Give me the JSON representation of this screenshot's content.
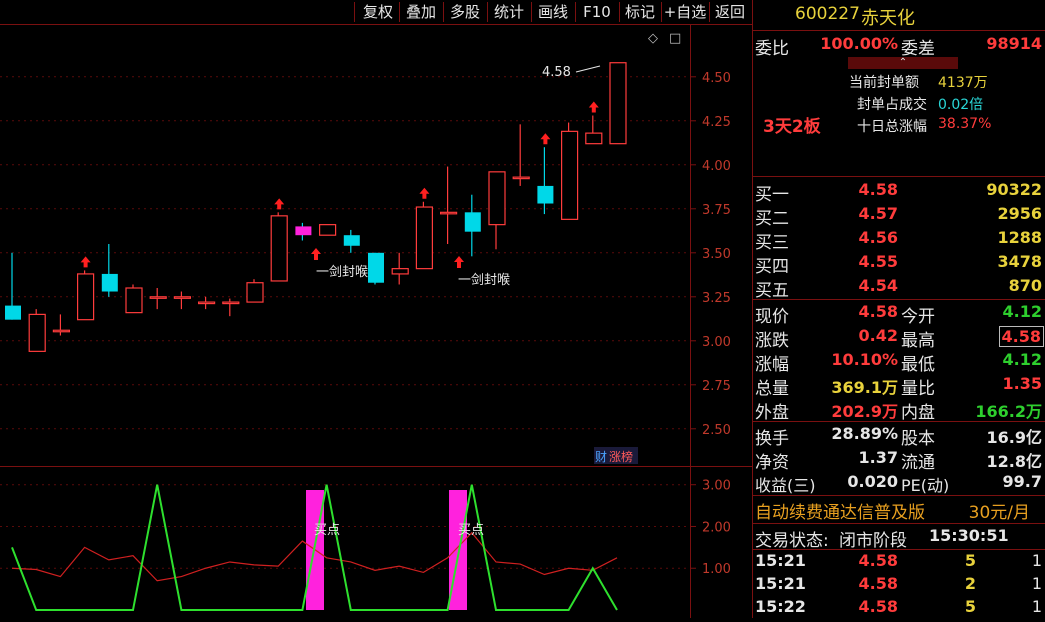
{
  "toolbar": {
    "buttons": [
      "复权",
      "叠加",
      "多股",
      "统计",
      "画线",
      "F10",
      "标记",
      "+自选",
      "返回"
    ]
  },
  "stock": {
    "code": "600227",
    "name": "赤天化"
  },
  "chart_icons": {
    "diamond": "◇",
    "window": "□"
  },
  "price_axis": {
    "labels": [
      "4.50",
      "4.25",
      "4.00",
      "3.75",
      "3.50",
      "3.25",
      "3.00",
      "2.75",
      "2.50"
    ]
  },
  "indicator_axis": {
    "labels": [
      "3.00",
      "2.00",
      "1.00"
    ]
  },
  "annotations": {
    "high_label": "4.58",
    "signal_1": "一剑封喉",
    "signal_2": "一剑封喉",
    "buy_1": "买点",
    "buy_2": "买点",
    "fin_badge_1": "财",
    "fin_badge_2": "涨榜"
  },
  "chart_data": {
    "type": "candlestick",
    "candles": [
      {
        "o": 3.2,
        "h": 3.5,
        "l": 3.12,
        "c": 3.12
      },
      {
        "o": 2.94,
        "h": 3.18,
        "l": 2.94,
        "c": 3.15
      },
      {
        "o": 3.06,
        "h": 3.15,
        "l": 3.03,
        "c": 3.06
      },
      {
        "o": 3.12,
        "h": 3.4,
        "l": 3.12,
        "c": 3.38
      },
      {
        "o": 3.38,
        "h": 3.55,
        "l": 3.25,
        "c": 3.28
      },
      {
        "o": 3.16,
        "h": 3.32,
        "l": 3.16,
        "c": 3.3
      },
      {
        "o": 3.25,
        "h": 3.3,
        "l": 3.18,
        "c": 3.25
      },
      {
        "o": 3.25,
        "h": 3.28,
        "l": 3.18,
        "c": 3.25
      },
      {
        "o": 3.22,
        "h": 3.25,
        "l": 3.18,
        "c": 3.22
      },
      {
        "o": 3.22,
        "h": 3.24,
        "l": 3.14,
        "c": 3.22
      },
      {
        "o": 3.22,
        "h": 3.35,
        "l": 3.22,
        "c": 3.33
      },
      {
        "o": 3.34,
        "h": 3.73,
        "l": 3.34,
        "c": 3.71
      },
      {
        "o": 3.65,
        "h": 3.67,
        "l": 3.57,
        "c": 3.6
      },
      {
        "o": 3.6,
        "h": 3.66,
        "l": 3.6,
        "c": 3.66
      },
      {
        "o": 3.6,
        "h": 3.63,
        "l": 3.5,
        "c": 3.54
      },
      {
        "o": 3.5,
        "h": 3.5,
        "l": 3.32,
        "c": 3.33
      },
      {
        "o": 3.38,
        "h": 3.5,
        "l": 3.32,
        "c": 3.41
      },
      {
        "o": 3.41,
        "h": 3.79,
        "l": 3.41,
        "c": 3.76
      },
      {
        "o": 3.73,
        "h": 3.99,
        "l": 3.55,
        "c": 3.73
      },
      {
        "o": 3.73,
        "h": 3.83,
        "l": 3.48,
        "c": 3.62
      },
      {
        "o": 3.66,
        "h": 3.96,
        "l": 3.52,
        "c": 3.96
      },
      {
        "o": 3.93,
        "h": 4.23,
        "l": 3.88,
        "c": 3.93
      },
      {
        "o": 3.88,
        "h": 4.1,
        "l": 3.72,
        "c": 3.78
      },
      {
        "o": 3.69,
        "h": 4.24,
        "l": 3.69,
        "c": 4.19
      },
      {
        "o": 4.12,
        "h": 4.28,
        "l": 4.12,
        "c": 4.18
      },
      {
        "o": 4.12,
        "h": 4.58,
        "l": 4.12,
        "c": 4.58
      }
    ],
    "ylim": [
      2.3,
      4.8
    ],
    "up_arrows_at": [
      2,
      10,
      16,
      21,
      23,
      24
    ],
    "indicator": {
      "green": [
        1.5,
        0,
        0,
        0,
        0,
        0,
        3,
        0,
        0,
        0,
        0,
        0,
        0,
        3,
        0,
        0,
        0,
        0,
        0,
        3,
        0,
        0,
        0,
        0,
        1,
        0
      ],
      "red": [
        1,
        0.97,
        0.8,
        1.5,
        1.2,
        1.3,
        0.7,
        0.8,
        1.0,
        1.15,
        1.08,
        1.05,
        1.65,
        1.25,
        1.15,
        0.95,
        1.05,
        0.9,
        1.25,
        1.85,
        1.15,
        1.1,
        0.85,
        1.0,
        0.95,
        1.25
      ],
      "buy_bars_at": [
        13,
        19
      ],
      "ylim": [
        0,
        3.4
      ]
    }
  },
  "panel": {
    "weibi_label": "委比",
    "weibi_value": "100.00%",
    "weicha_label": "委差",
    "weicha_value": "98914",
    "seal_amount_label": "当前封单额",
    "seal_amount_value": "4137万",
    "seal_ratio_label": "封单占成交",
    "seal_ratio_value": "0.02倍",
    "ten_day_label": "十日总涨幅",
    "ten_day_value": "38.37%",
    "streak": "3天2板",
    "bids": [
      {
        "label": "买一",
        "price": "4.58",
        "vol": "90322"
      },
      {
        "label": "买二",
        "price": "4.57",
        "vol": "2956"
      },
      {
        "label": "买三",
        "price": "4.56",
        "vol": "1288"
      },
      {
        "label": "买四",
        "price": "4.55",
        "vol": "3478"
      },
      {
        "label": "买五",
        "price": "4.54",
        "vol": "870"
      }
    ],
    "stats": [
      {
        "l1": "现价",
        "v1": "4.58",
        "l2": "今开",
        "v2": "4.12"
      },
      {
        "l1": "涨跌",
        "v1": "0.42",
        "l2": "最高",
        "v2": "4.58"
      },
      {
        "l1": "涨幅",
        "v1": "10.10%",
        "l2": "最低",
        "v2": "4.12"
      },
      {
        "l1": "总量",
        "v1": "369.1万",
        "l2": "量比",
        "v2": "1.35"
      },
      {
        "l1": "外盘",
        "v1": "202.9万",
        "l2": "内盘",
        "v2": "166.2万"
      }
    ],
    "fund": [
      {
        "l1": "换手",
        "v1": "28.89%",
        "l2": "股本",
        "v2": "16.9亿"
      },
      {
        "l1": "净资",
        "v1": "1.37",
        "l2": "流通",
        "v2": "12.8亿"
      },
      {
        "l1": "收益(三)",
        "v1": "0.020",
        "l2": "PE(动)",
        "v2": "99.7"
      }
    ],
    "promo": "自动续费通达信普及版",
    "promo_price": "30元/月",
    "trade_status_label": "交易状态:",
    "trade_status_value": "闭市阶段",
    "trade_time": "15:30:51",
    "ticks": [
      {
        "time": "15:21",
        "price": "4.58",
        "vol": "5",
        "n": "1"
      },
      {
        "time": "15:21",
        "price": "4.58",
        "vol": "2",
        "n": "1"
      },
      {
        "time": "15:22",
        "price": "4.58",
        "vol": "5",
        "n": "1"
      }
    ]
  }
}
